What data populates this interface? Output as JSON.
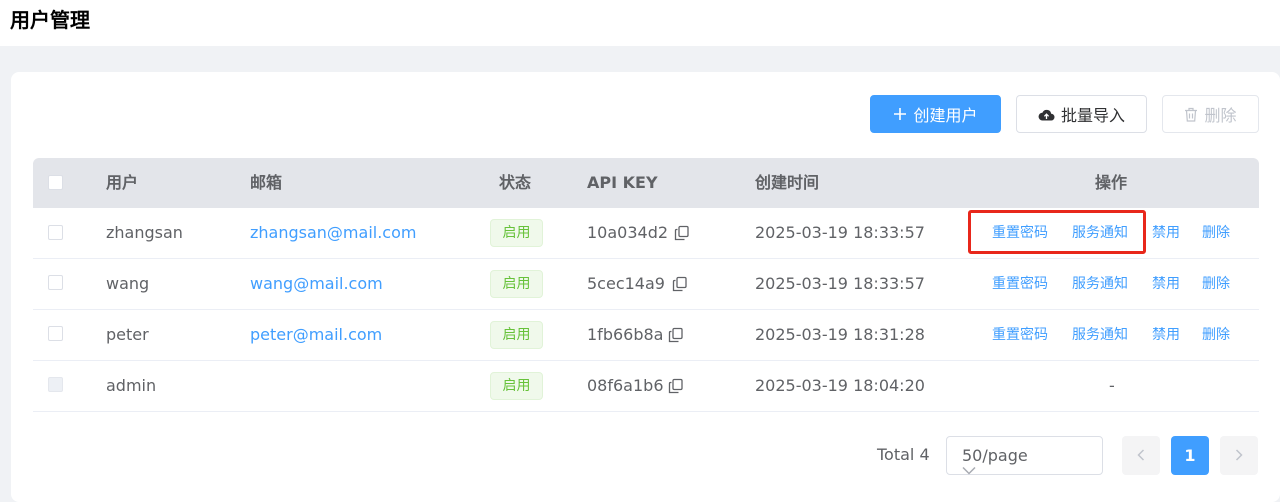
{
  "page": {
    "title": "用户管理"
  },
  "toolbar": {
    "create_label": "创建用户",
    "import_label": "批量导入",
    "delete_label": "删除"
  },
  "table": {
    "headers": {
      "user": "用户",
      "email": "邮箱",
      "status": "状态",
      "apikey": "API KEY",
      "created": "创建时间",
      "actions": "操作"
    },
    "rows": [
      {
        "user": "zhangsan",
        "email": "zhangsan@mail.com",
        "status": "启用",
        "apikey": "10a034d2",
        "created": "2025-03-19 18:33:57"
      },
      {
        "user": "wang",
        "email": "wang@mail.com",
        "status": "启用",
        "apikey": "5cec14a9",
        "created": "2025-03-19 18:33:57"
      },
      {
        "user": "peter",
        "email": "peter@mail.com",
        "status": "启用",
        "apikey": "1fb66b8a",
        "created": "2025-03-19 18:31:28"
      },
      {
        "user": "admin",
        "email": "",
        "status": "启用",
        "apikey": "08f6a1b6",
        "created": "2025-03-19 18:04:20",
        "actions_placeholder": "-"
      }
    ],
    "actions": {
      "reset_password": "重置密码",
      "service_notice": "服务通知",
      "disable": "禁用",
      "delete": "删除"
    }
  },
  "pagination": {
    "total": "Total 4",
    "page_size": "50/page",
    "current_page": "1"
  },
  "colors": {
    "primary": "#409eff",
    "success": "#67c23a",
    "highlight": "#e8271b"
  }
}
